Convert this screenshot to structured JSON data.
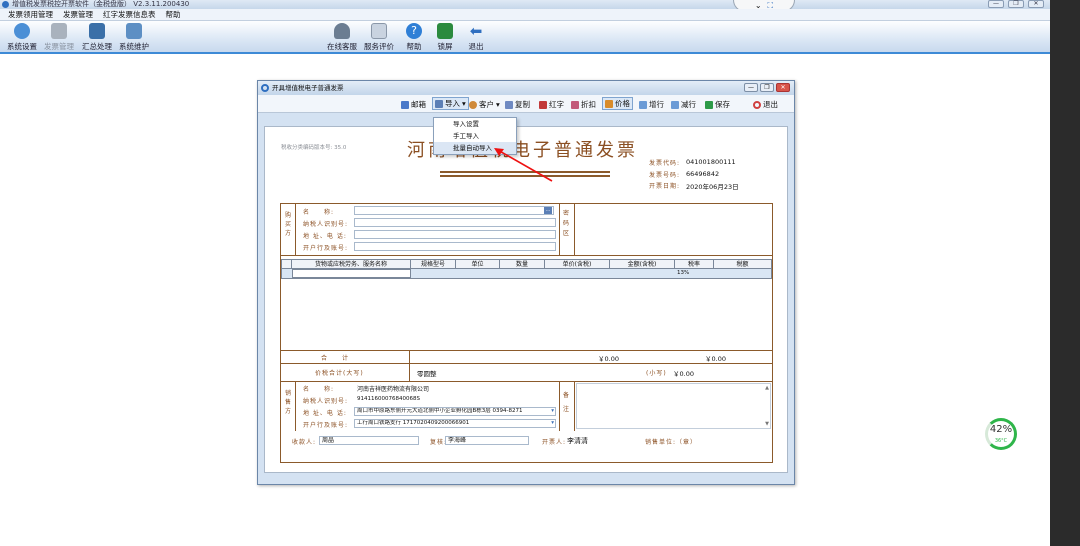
{
  "app": {
    "title": "增值税发票税控开票软件（金税盘版） V2.3.11.200430"
  },
  "menu": [
    "发票领用管理",
    "发票管理",
    "红字发票信息表",
    "帮助"
  ],
  "toolbar": {
    "left": [
      "系统设置",
      "发票管理",
      "汇总处理",
      "系统维护"
    ],
    "right": [
      "在线客服",
      "服务评价",
      "帮助",
      "锁屏",
      "退出"
    ]
  },
  "gauge": {
    "percent": "42%",
    "temp": "36°C"
  },
  "dialog": {
    "title": "开具增值税电子普通发票",
    "tools": [
      "邮箱",
      "导入",
      "客户",
      "复制",
      "红字",
      "折扣",
      "价格",
      "增行",
      "减行",
      "保存",
      "退出"
    ],
    "import_menu": [
      "导入设置",
      "手工导入",
      "批量自动导入"
    ]
  },
  "invoice": {
    "tax_version": "税收分类编码版本号: 35.0",
    "title": "河南增值税电子普通发票",
    "meta_labels": [
      "发票代码:",
      "发票号码:",
      "开票日期:"
    ],
    "code": "041001800111",
    "number": "66496842",
    "date": "2020年06月23日",
    "buyer_side": "购买方",
    "buyer_labels": [
      "名　　称:",
      "纳税人识别号:",
      "地 址、电 话:",
      "开户行及账号:"
    ],
    "cipher_side": "密码区",
    "columns": [
      "货物或应税劳务、服务名称",
      "规格型号",
      "单位",
      "数量",
      "单价(含税)",
      "金额(含税)",
      "税率",
      "税额"
    ],
    "row_rate": "13%",
    "total_label": "合　　计",
    "total_amount": "￥0.00",
    "total_tax": "￥0.00",
    "tax_total_label": "价税合计(大写)",
    "tax_total_words": "零圆整",
    "small_label": "(小写)",
    "small_amount": "￥0.00",
    "seller_side": "销售方",
    "seller_labels": [
      "名　　称:",
      "纳税人识别号:",
      "地 址、电 话:",
      "开户行及账号:"
    ],
    "seller_name": "河南吉祥医药物流有限公司",
    "seller_taxid": "91411600076840068S",
    "seller_addr": "周口市中原路东侧开元大道北侧中小企业孵化园B栋3层  0394-8271",
    "seller_bank": "工行周口铁路支行  1717020409200066901",
    "remark_side": "备注",
    "payee_label": "收款人:",
    "payee": "周晶",
    "checker_label": "复核:",
    "checker": "李海峰",
    "issuer_label": "开票人:",
    "issuer": "李清清",
    "seller_stamp": "销售单位:（章）"
  }
}
